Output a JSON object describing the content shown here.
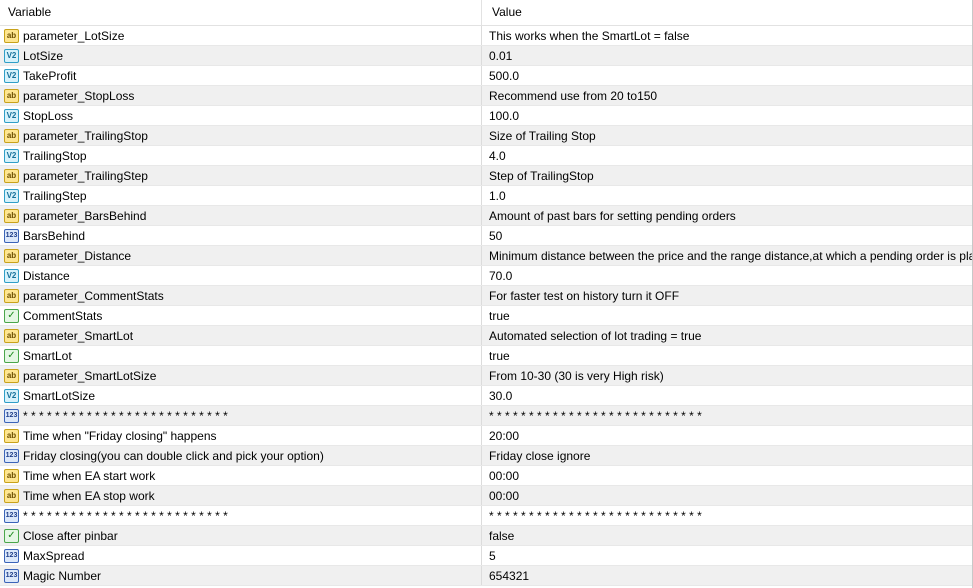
{
  "header": {
    "col_variable": "Variable",
    "col_value": "Value"
  },
  "rows": [
    {
      "icon": "ab",
      "name": "parameter_LotSize",
      "value": "This works when the SmartLot = false"
    },
    {
      "icon": "v2",
      "name": "LotSize",
      "value": "0.01"
    },
    {
      "icon": "v2",
      "name": "TakeProfit",
      "value": "500.0"
    },
    {
      "icon": "ab",
      "name": "parameter_StopLoss",
      "value": "Recommend use from 20 to150"
    },
    {
      "icon": "v2",
      "name": "StopLoss",
      "value": "100.0"
    },
    {
      "icon": "ab",
      "name": "parameter_TrailingStop",
      "value": "Size of Trailing Stop"
    },
    {
      "icon": "v2",
      "name": "TrailingStop",
      "value": "4.0"
    },
    {
      "icon": "ab",
      "name": "parameter_TrailingStep",
      "value": "Step of TrailingStop"
    },
    {
      "icon": "v2",
      "name": "TrailingStep",
      "value": "1.0"
    },
    {
      "icon": "ab",
      "name": "parameter_BarsBehind",
      "value": "Amount of past bars for setting pending orders"
    },
    {
      "icon": "123",
      "name": "BarsBehind",
      "value": "50"
    },
    {
      "icon": "ab",
      "name": "parameter_Distance",
      "value": "Minimum distance between the price and the range distance,at which a pending order is placed"
    },
    {
      "icon": "v2",
      "name": "Distance",
      "value": "70.0"
    },
    {
      "icon": "ab",
      "name": "parameter_CommentStats",
      "value": "For faster test on history turn it OFF"
    },
    {
      "icon": "bool",
      "name": "CommentStats",
      "value": "true"
    },
    {
      "icon": "ab",
      "name": "parameter_SmartLot",
      "value": "Automated selection of  lot trading = true"
    },
    {
      "icon": "bool",
      "name": "SmartLot",
      "value": "true"
    },
    {
      "icon": "ab",
      "name": "parameter_SmartLotSize",
      "value": "From 10-30 (30 is very High risk)"
    },
    {
      "icon": "v2",
      "name": "SmartLotSize",
      "value": "30.0"
    },
    {
      "icon": "123",
      "name": "* * * * * * * * * * * * * * * * * * * * * * * * * *",
      "value": "* * * * * * * * * * * * * * * * * * * * * * * * * * *"
    },
    {
      "icon": "ab",
      "name": "Time when \"Friday closing\" happens",
      "value": "20:00"
    },
    {
      "icon": "123",
      "name": "Friday closing(you can double click and pick your option)",
      "value": "Friday close ignore"
    },
    {
      "icon": "ab",
      "name": "Time when EA start work",
      "value": "00:00"
    },
    {
      "icon": "ab",
      "name": "Time when EA stop work",
      "value": "00:00"
    },
    {
      "icon": "123",
      "name": "* * * * * * * * * * * * * * * * * * * * * * * * * *",
      "value": "* * * * * * * * * * * * * * * * * * * * * * * * * * *"
    },
    {
      "icon": "bool",
      "name": "Close after pinbar",
      "value": "false"
    },
    {
      "icon": "123",
      "name": "MaxSpread",
      "value": "5"
    },
    {
      "icon": "123",
      "name": "Magic Number",
      "value": "654321"
    }
  ],
  "icon_glyphs": {
    "ab": "ab",
    "v2": "V2",
    "123": "123",
    "bool": "✓"
  }
}
